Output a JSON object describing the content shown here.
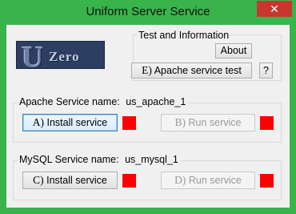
{
  "window": {
    "title": "Uniform Server Service",
    "close_glyph": "✕"
  },
  "logo": {
    "u": "U",
    "zero": "Zero"
  },
  "test_info": {
    "label": "Test and Information",
    "about": "About",
    "apache_test_key": "E)",
    "apache_test": "Apache service test",
    "help": "?"
  },
  "apache": {
    "label": "Apache Service name:",
    "service_name": "us_apache_1",
    "install_key": "A)",
    "install": "Install service",
    "run_key": "B)",
    "run": "Run service"
  },
  "mysql": {
    "label": "MySQL Service name:",
    "service_name": "us_mysql_1",
    "install_key": "C)",
    "install": "Install service",
    "run_key": "D)",
    "run": "Run service"
  },
  "colors": {
    "titlebar": "#38b44a",
    "indicator_stopped": "#ff0000",
    "close": "#c7372f"
  }
}
